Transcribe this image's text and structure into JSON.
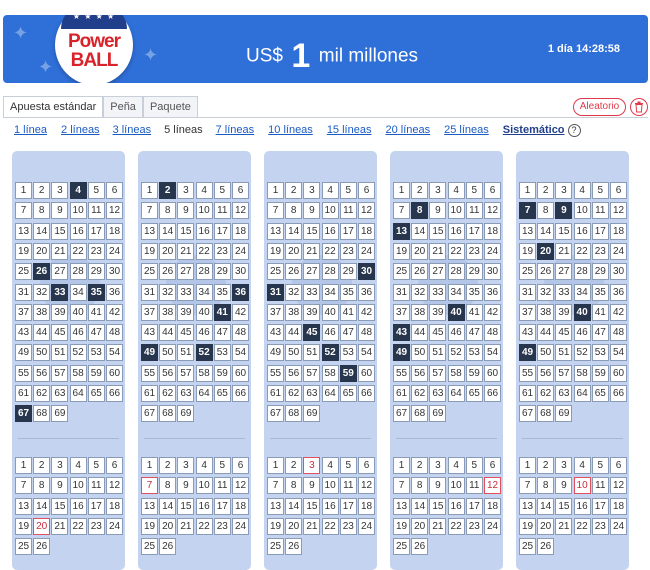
{
  "header": {
    "logo_line1": "Power",
    "logo_line2": "BALL",
    "jackpot_currency": "US$",
    "jackpot_amount": "1",
    "jackpot_unit": "mil millones",
    "countdown": "1 día 14:28:58",
    "banner_color": "#2f6fd8"
  },
  "tabs": [
    {
      "label": "Apuesta estándar",
      "active": true
    },
    {
      "label": "Peña",
      "active": false
    },
    {
      "label": "Paquete",
      "active": false
    }
  ],
  "actions": {
    "random_label": "Aleatorio",
    "delete_icon": "trash-icon"
  },
  "line_options": [
    {
      "label": "1 línea"
    },
    {
      "label": "2 líneas"
    },
    {
      "label": "3 líneas"
    },
    {
      "label": "5 líneas",
      "selected": true
    },
    {
      "label": "7 líneas"
    },
    {
      "label": "10 líneas"
    },
    {
      "label": "15 líneas"
    },
    {
      "label": "20 líneas"
    },
    {
      "label": "25 líneas"
    },
    {
      "label": "Sistemático",
      "bold": true
    }
  ],
  "help_icon": "?",
  "tickets": [
    {
      "main_selected": [
        4,
        26,
        33,
        35,
        67
      ],
      "powerball_selected": [
        20
      ]
    },
    {
      "main_selected": [
        2,
        36,
        41,
        49,
        52
      ],
      "powerball_selected": [
        7
      ]
    },
    {
      "main_selected": [
        30,
        31,
        45,
        52,
        59
      ],
      "powerball_selected": [
        3
      ]
    },
    {
      "main_selected": [
        8,
        13,
        40,
        43,
        49
      ],
      "powerball_selected": [
        12
      ]
    },
    {
      "main_selected": [
        7,
        9,
        20,
        40,
        49
      ],
      "powerball_selected": [
        10
      ]
    }
  ],
  "main_range": 69,
  "powerball_range": 26
}
